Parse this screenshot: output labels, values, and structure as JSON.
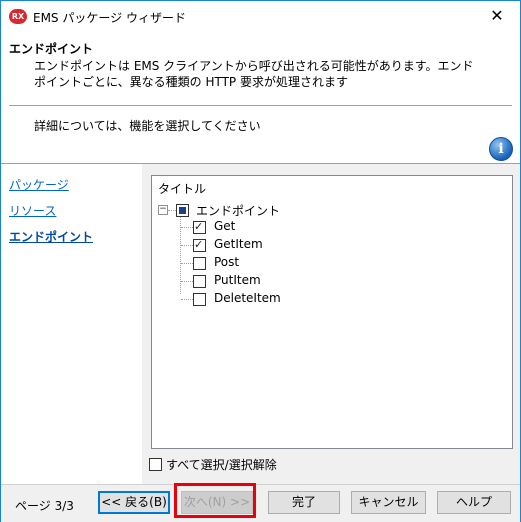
{
  "window": {
    "title": "EMS パッケージ ウィザード",
    "app_icon_text": "RX",
    "close_glyph": "✕"
  },
  "header": {
    "title": "エンドポイント",
    "description": "エンドポイントは EMS クライアントから呼び出される可能性があります。エンドポイントごとに、異なる種類の HTTP 要求が処理されます",
    "subtitle": "詳細については、機能を選択してください",
    "info_glyph": "i"
  },
  "nav": {
    "items": [
      {
        "label": "パッケージ"
      },
      {
        "label": "リソース"
      },
      {
        "label": "エンドポイント"
      }
    ]
  },
  "tree": {
    "header": "タイトル",
    "expander_glyph": "−",
    "root": {
      "label": "エンドポイント",
      "state": "indeterminate"
    },
    "children": [
      {
        "label": "Get",
        "checked": true
      },
      {
        "label": "GetItem",
        "checked": true
      },
      {
        "label": "Post",
        "checked": false
      },
      {
        "label": "PutItem",
        "checked": false
      },
      {
        "label": "DeleteItem",
        "checked": false
      }
    ]
  },
  "select_all": {
    "label": "すべて選択/選択解除",
    "checked": false
  },
  "footer": {
    "page_indicator": "ページ 3/3",
    "back_label": "<< 戻る(B)",
    "next_label": "次へ(N) >>",
    "finish_label": "完了",
    "cancel_label": "キャンセル",
    "help_label": "ヘルプ"
  },
  "colors": {
    "accent": "#0078d7",
    "highlight": "#e8000d",
    "link": "#0066cc"
  }
}
